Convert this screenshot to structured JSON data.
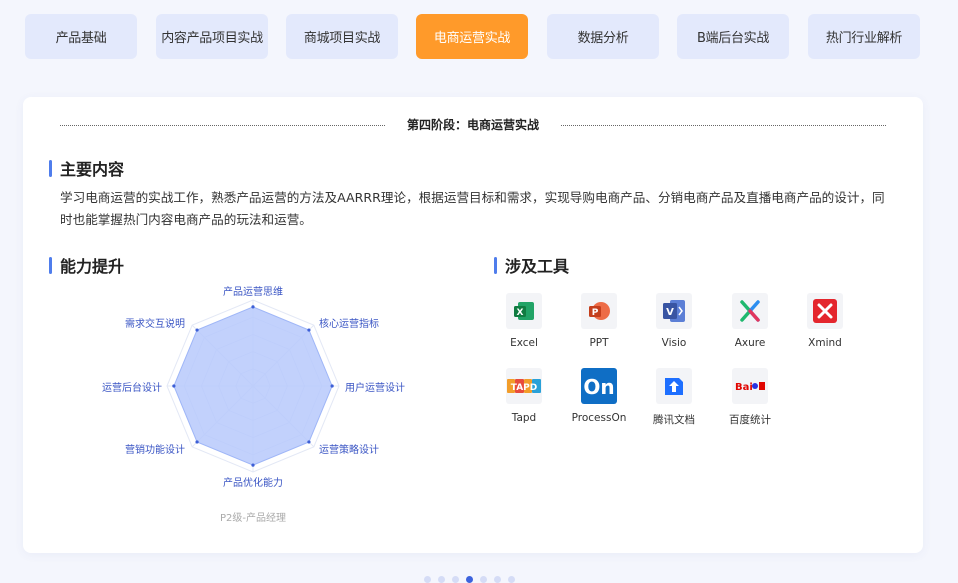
{
  "tabs": [
    {
      "label": "产品基础",
      "active": false
    },
    {
      "label": "内容产品项目实战",
      "active": false
    },
    {
      "label": "商城项目实战",
      "active": false
    },
    {
      "label": "电商运营实战",
      "active": true
    },
    {
      "label": "数据分析",
      "active": false
    },
    {
      "label": "B端后台实战",
      "active": false
    },
    {
      "label": "热门行业解析",
      "active": false
    }
  ],
  "stage": {
    "title": "第四阶段：电商运营实战"
  },
  "main_content": {
    "title": "主要内容",
    "text": "学习电商运营的实战工作，熟悉产品运营的方法及AARRR理论，根据运营目标和需求，实现导购电商产品、分销电商产品及直播电商产品的设计，同时也能掌握热门内容电商产品的玩法和运营。"
  },
  "ability": {
    "title": "能力提升",
    "level_label": "P2级-产品经理",
    "axes": [
      "产品运营思维",
      "核心运营指标",
      "用户运营设计",
      "运营策略设计",
      "产品优化能力",
      "营销功能设计",
      "运营后台设计",
      "需求交互说明"
    ]
  },
  "tools": {
    "title": "涉及工具",
    "items": [
      {
        "label": "Excel",
        "icon": "excel-icon",
        "color": "#1d7044"
      },
      {
        "label": "PPT",
        "icon": "powerpoint-icon",
        "color": "#d24726"
      },
      {
        "label": "Visio",
        "icon": "visio-icon",
        "color": "#3955a3"
      },
      {
        "label": "Axure",
        "icon": "axure-icon",
        "color": "#2d8ef0"
      },
      {
        "label": "Xmind",
        "icon": "xmind-icon",
        "color": "#e4262d"
      },
      {
        "label": "Tapd",
        "icon": "tapd-icon",
        "color": "#f29d2a"
      },
      {
        "label": "ProcessOn",
        "icon": "processon-icon",
        "color": "#0f6ec5"
      },
      {
        "label": "腾讯文档",
        "icon": "tencent-docs-icon",
        "color": "#1e6fff"
      },
      {
        "label": "百度统计",
        "icon": "baidu-tongji-icon",
        "color": "#e10602"
      }
    ]
  },
  "pagination": {
    "count": 7,
    "active_index": 3
  }
}
